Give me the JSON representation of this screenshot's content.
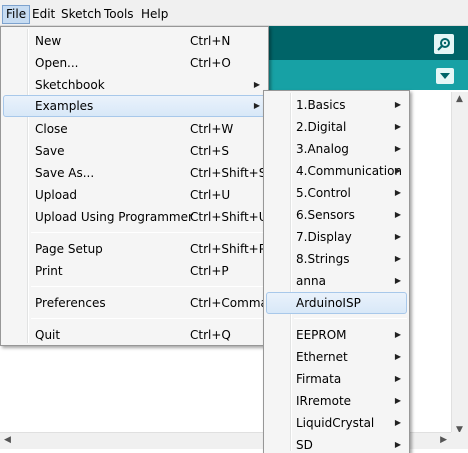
{
  "menubar": {
    "items": [
      {
        "label": "File",
        "active": true
      },
      {
        "label": "Edit"
      },
      {
        "label": "Sketch"
      },
      {
        "label": "Tools"
      },
      {
        "label": "Help"
      }
    ]
  },
  "file_menu": {
    "items": [
      {
        "label": "New",
        "shortcut": "Ctrl+N"
      },
      {
        "label": "Open...",
        "shortcut": "Ctrl+O"
      },
      {
        "label": "Sketchbook",
        "submenu": true
      },
      {
        "label": "Examples",
        "submenu": true,
        "highlighted": true
      },
      {
        "label": "Close",
        "shortcut": "Ctrl+W"
      },
      {
        "label": "Save",
        "shortcut": "Ctrl+S"
      },
      {
        "label": "Save As...",
        "shortcut": "Ctrl+Shift+S"
      },
      {
        "label": "Upload",
        "shortcut": "Ctrl+U"
      },
      {
        "label": "Upload Using Programmer",
        "shortcut": "Ctrl+Shift+U"
      },
      {
        "label": "Page Setup",
        "shortcut": "Ctrl+Shift+P"
      },
      {
        "label": "Print",
        "shortcut": "Ctrl+P"
      },
      {
        "label": "Preferences",
        "shortcut": "Ctrl+Comma"
      },
      {
        "label": "Quit",
        "shortcut": "Ctrl+Q"
      }
    ]
  },
  "examples_menu": {
    "items": [
      {
        "label": "1.Basics",
        "submenu": true
      },
      {
        "label": "2.Digital",
        "submenu": true
      },
      {
        "label": "3.Analog",
        "submenu": true
      },
      {
        "label": "4.Communication",
        "submenu": true
      },
      {
        "label": "5.Control",
        "submenu": true
      },
      {
        "label": "6.Sensors",
        "submenu": true
      },
      {
        "label": "7.Display",
        "submenu": true
      },
      {
        "label": "8.Strings",
        "submenu": true
      },
      {
        "label": "anna",
        "submenu": true
      },
      {
        "label": "ArduinoISP",
        "highlighted": true
      },
      {
        "label": "EEPROM",
        "submenu": true
      },
      {
        "label": "Ethernet",
        "submenu": true
      },
      {
        "label": "Firmata",
        "submenu": true
      },
      {
        "label": "IRremote",
        "submenu": true
      },
      {
        "label": "LiquidCrystal",
        "submenu": true
      },
      {
        "label": "SD",
        "submenu": true
      }
    ]
  },
  "icons": {
    "submenu_arrow": "▶",
    "serial_monitor": "serial-monitor-icon",
    "tab_menu": "chevron-down-icon"
  },
  "colors": {
    "toolbar": "#006468",
    "tabbar": "#17a1a5",
    "menu_bg": "#f5f5f5",
    "highlight": "#d8e8f8"
  }
}
